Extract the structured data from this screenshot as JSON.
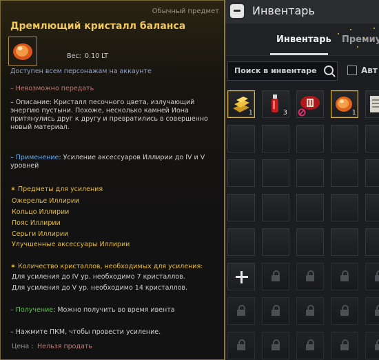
{
  "inventory": {
    "title": "Инвентарь",
    "tabs": [
      "Инвентарь",
      "Премиум"
    ],
    "search_placeholder": "Поиск в инвентаре",
    "auto_label": "Авт",
    "items": [
      {
        "name": "gold-bars",
        "count": "1"
      },
      {
        "name": "red-potion",
        "count": "3"
      },
      {
        "name": "red-belt",
        "count": ""
      },
      {
        "name": "balance-crystal",
        "count": "1"
      },
      {
        "name": "scroll",
        "count": ""
      }
    ]
  },
  "tooltip": {
    "grade": "Обычный предмет",
    "item_name": "Дремлющий кристалл баланса",
    "weight_label": "Вес:",
    "weight_value": "0.10 LT",
    "account_note": "Доступен всем персонажам на аккаунте",
    "not_transferable": "– Невозможно передать",
    "description": "– Описание: Кристалл песочного цвета, излучающий энергию пустыни. Похоже, несколько камней Иона притянулись друг к другу и превратились в совершенно новый материал.",
    "usage_label": "– Применение",
    "usage_text": ": Усиление аксессуаров Иллирии до IV и V уровней",
    "enhance_head": "✶ Предметы для усиления",
    "enhance_items": [
      "Ожерелье Иллирии",
      "Кольцо Иллирии",
      "Пояс Иллирии",
      "Серьги Иллирии",
      "Улучшенные аксессуары Иллирии"
    ],
    "crystals_head": "✶ Количество кристаллов, необходимых для усиления:",
    "crystals_lines": [
      "Для усиления до IV ур. необходимо 7 кристаллов.",
      "Для усиления до V ур. необходимо 14 кристаллов."
    ],
    "obtain_label": "– Получение",
    "obtain_text": ": Можно получить во время ивента",
    "hint": "– Нажмите ПКМ, чтобы провести усиление.",
    "price_label": "Цена :",
    "price_value": "Нельзя продать"
  }
}
